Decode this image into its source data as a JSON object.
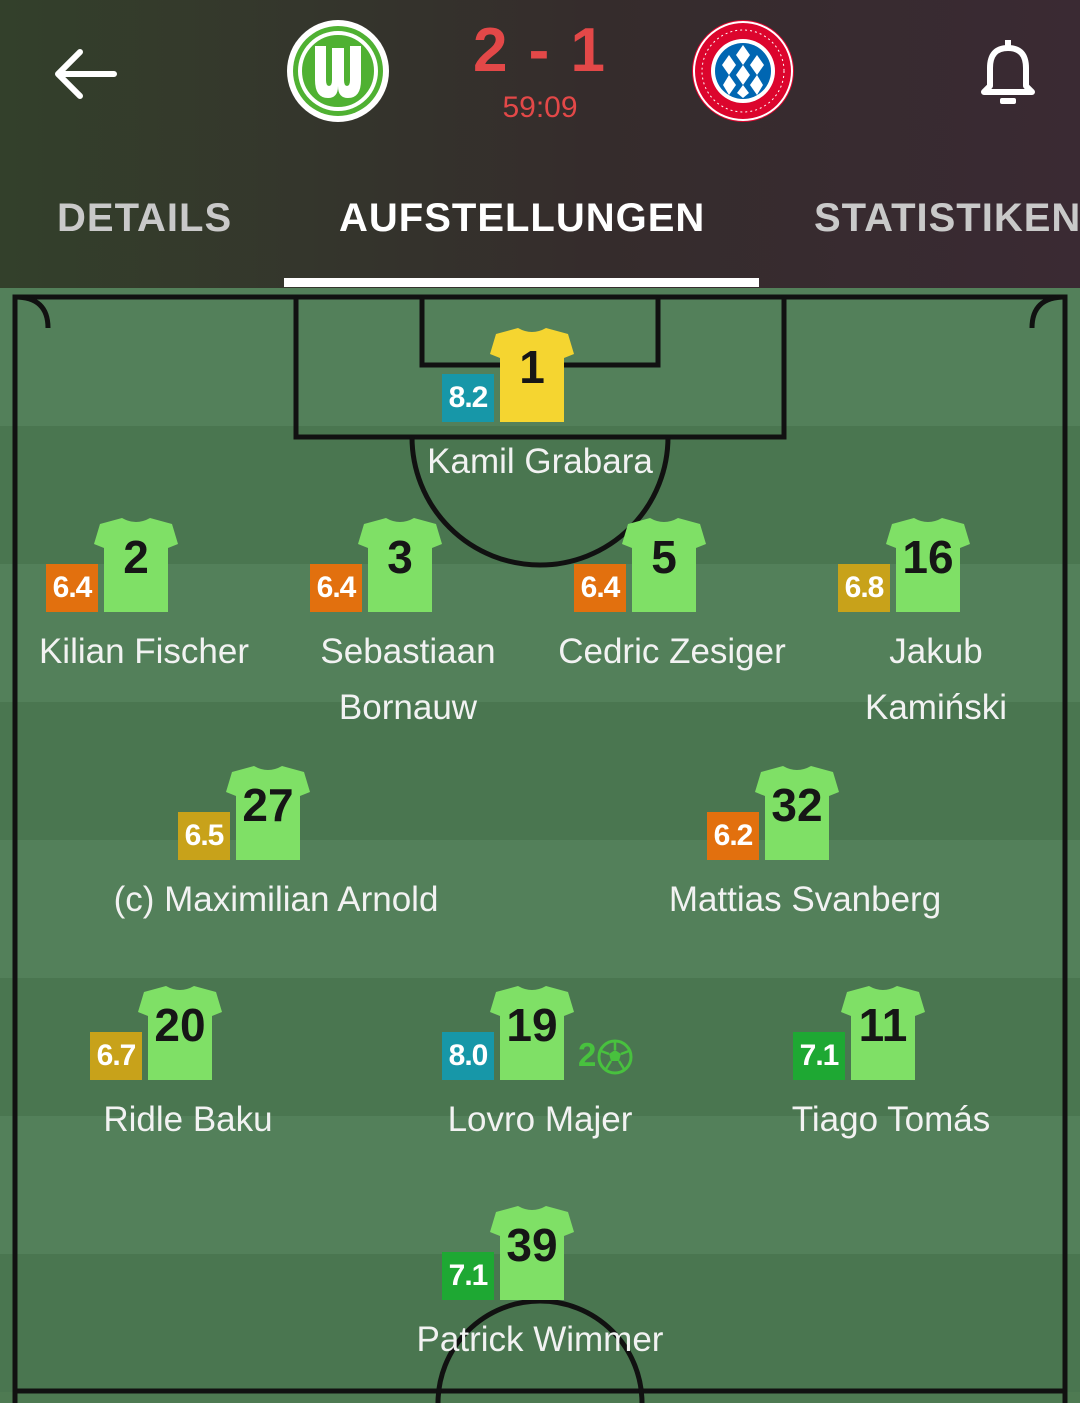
{
  "match": {
    "score": "2 - 1",
    "clock": "59:09",
    "home_team_icon": "vfl-wolfsburg-crest",
    "away_team_icon": "fc-bayern-muenchen-crest",
    "score_color": "#e34848"
  },
  "tabs": [
    {
      "label": "DETAILS",
      "active": false
    },
    {
      "label": "AUFSTELLUNGEN",
      "active": true
    },
    {
      "label": "STATISTIKEN",
      "active": false
    }
  ],
  "colors": {
    "pitch_light": "#53805a",
    "pitch_dark": "#4a7650",
    "jersey_outfield": "#7fe066",
    "jersey_goalkeeper": "#f5d530",
    "rating_blue": "#1797a8",
    "rating_green": "#1ea833",
    "rating_olive": "#c8a21a",
    "rating_orange": "#e2700e",
    "goal_green": "#48c13e"
  },
  "lineup": {
    "goalkeeper": {
      "number": "1",
      "name": "Kamil Grabara",
      "rating": "8.2",
      "rating_color": "#1797a8"
    },
    "defenders": [
      {
        "number": "2",
        "name": "Kilian Fischer",
        "rating": "6.4",
        "rating_color": "#e2700e"
      },
      {
        "number": "3",
        "name": "Sebastiaan Bornauw",
        "rating": "6.4",
        "rating_color": "#e2700e"
      },
      {
        "number": "5",
        "name": "Cedric Zesiger",
        "rating": "6.4",
        "rating_color": "#e2700e"
      },
      {
        "number": "16",
        "name": "Jakub Kamiński",
        "rating": "6.8",
        "rating_color": "#c8a21a"
      }
    ],
    "midfield_center": [
      {
        "number": "27",
        "name": "(c) Maximilian Arnold",
        "rating": "6.5",
        "rating_color": "#c8a21a"
      },
      {
        "number": "32",
        "name": "Mattias Svanberg",
        "rating": "6.2",
        "rating_color": "#e2700e"
      }
    ],
    "midfield_attack": [
      {
        "number": "20",
        "name": "Ridle Baku",
        "rating": "6.7",
        "rating_color": "#c8a21a"
      },
      {
        "number": "19",
        "name": "Lovro Majer",
        "rating": "8.0",
        "rating_color": "#1797a8",
        "goals": "2",
        "goal_icon": "football-icon"
      },
      {
        "number": "11",
        "name": "Tiago Tomás",
        "rating": "7.1",
        "rating_color": "#1ea833"
      }
    ],
    "striker": {
      "number": "39",
      "name": "Patrick Wimmer",
      "rating": "7.1",
      "rating_color": "#1ea833"
    }
  }
}
